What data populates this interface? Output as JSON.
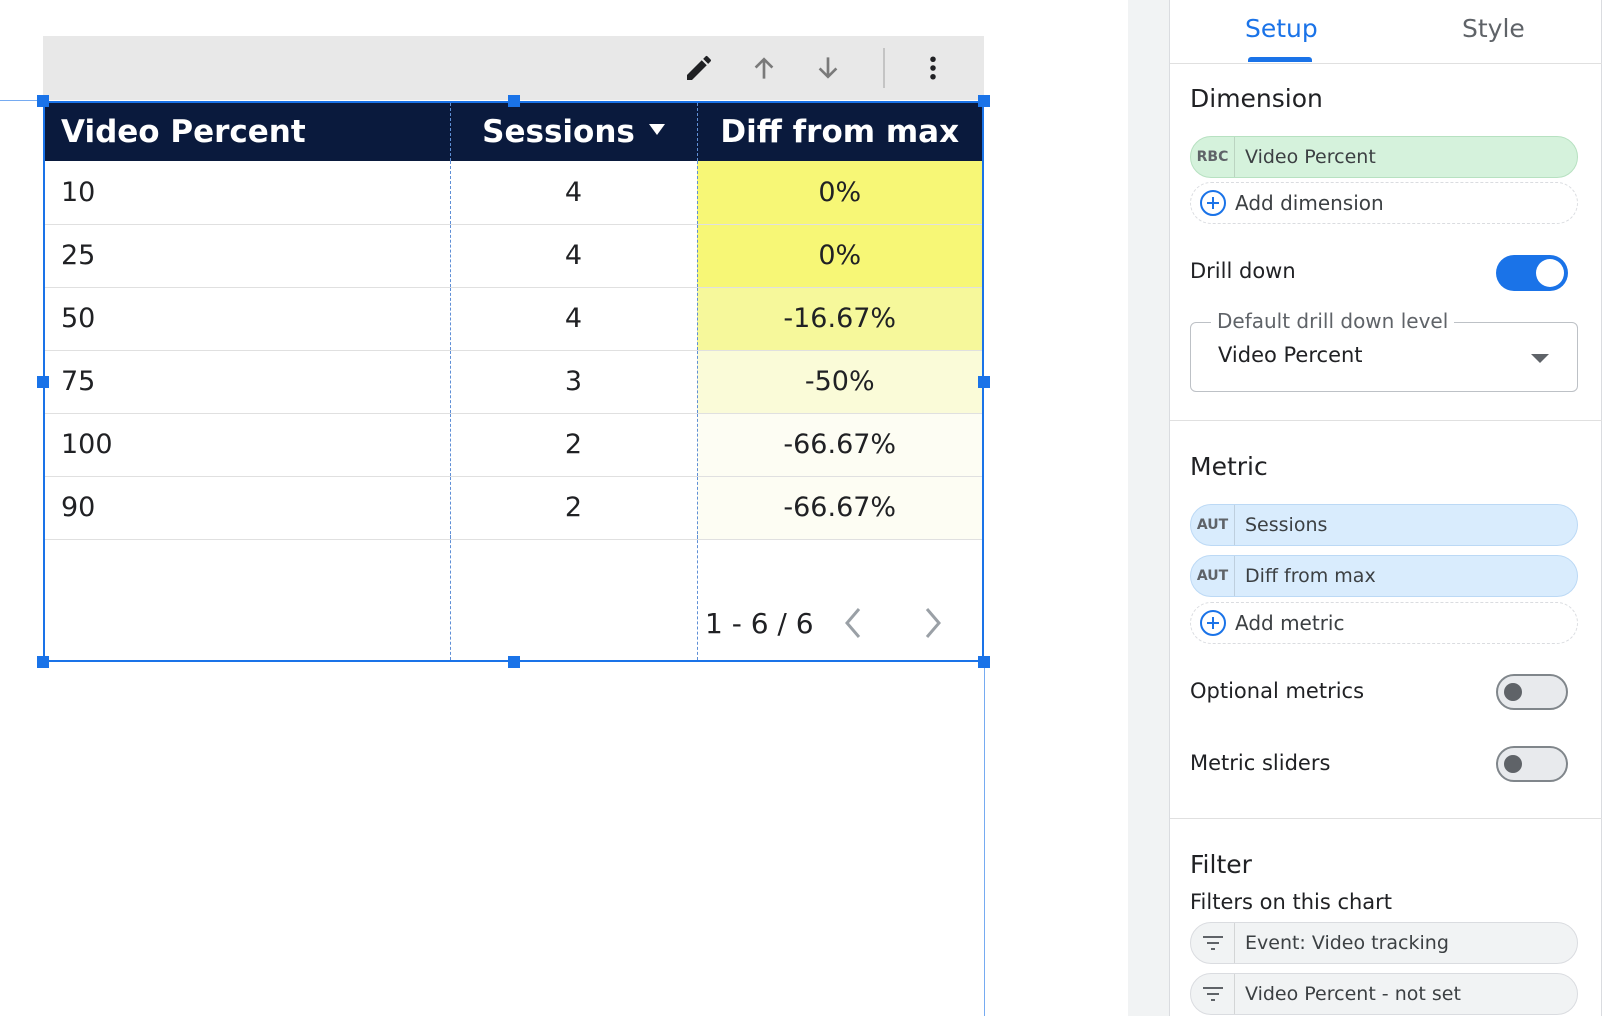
{
  "colors": {
    "accent": "#1a73e8",
    "header_bg": "#0a1a3d",
    "heat_0": "#f7f776",
    "heat_1": "#f6f89b",
    "heat_2": "#fafbd8",
    "heat_3": "#fdfdf3",
    "dimension_chip": "#d5f2dc",
    "metric_chip": "#d9ecfd"
  },
  "toolbar": {
    "icons": [
      "pencil-icon",
      "arrow-up-icon",
      "arrow-down-icon",
      "more-vert-icon"
    ]
  },
  "table": {
    "headers": [
      "Video Percent",
      "Sessions",
      "Diff from max"
    ],
    "sort_column": "Sessions",
    "sort_direction": "descending",
    "rows": [
      {
        "video_percent": "10",
        "sessions": "4",
        "diff": "0%",
        "heat": "#f7f776"
      },
      {
        "video_percent": "25",
        "sessions": "4",
        "diff": "0%",
        "heat": "#f7f776"
      },
      {
        "video_percent": "50",
        "sessions": "4",
        "diff": "-16.67%",
        "heat": "#f6f89b"
      },
      {
        "video_percent": "75",
        "sessions": "3",
        "diff": "-50%",
        "heat": "#fafbd8"
      },
      {
        "video_percent": "100",
        "sessions": "2",
        "diff": "-66.67%",
        "heat": "#fdfdf3"
      },
      {
        "video_percent": "90",
        "sessions": "2",
        "diff": "-66.67%",
        "heat": "#fdfdf3"
      }
    ],
    "pagination": "1 - 6 / 6"
  },
  "panel": {
    "tabs": [
      {
        "label": "Setup",
        "active": true
      },
      {
        "label": "Style",
        "active": false
      }
    ],
    "dimension": {
      "title": "Dimension",
      "chips": [
        {
          "tag": "RBC",
          "label": "Video Percent"
        }
      ],
      "add_label": "Add dimension"
    },
    "drill_down": {
      "label": "Drill down",
      "enabled": true,
      "default_level_label": "Default drill down level",
      "default_level_value": "Video Percent"
    },
    "metric": {
      "title": "Metric",
      "chips": [
        {
          "tag": "AUT",
          "label": "Sessions"
        },
        {
          "tag": "AUT",
          "label": "Diff from max"
        }
      ],
      "add_label": "Add metric"
    },
    "optional_metrics": {
      "label": "Optional metrics",
      "enabled": false
    },
    "metric_sliders": {
      "label": "Metric sliders",
      "enabled": false
    },
    "filter": {
      "title": "Filter",
      "subtitle": "Filters on this chart",
      "chips": [
        {
          "icon": "filter-icon",
          "label": "Event: Video tracking"
        },
        {
          "icon": "filter-icon",
          "label": "Video Percent - not set"
        }
      ]
    }
  }
}
